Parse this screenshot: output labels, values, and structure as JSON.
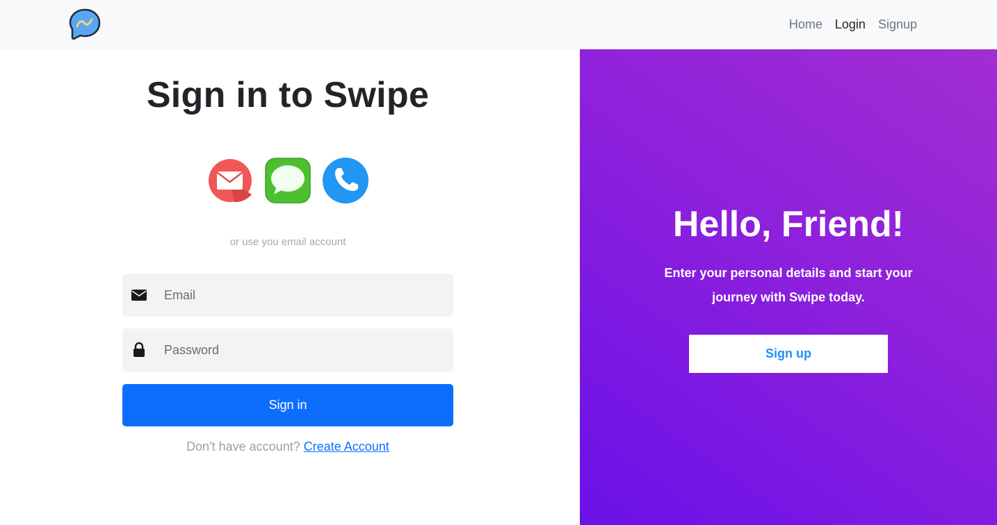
{
  "nav": {
    "brand_icon": "chat-bubble-logo-icon",
    "links": [
      {
        "label": "Home",
        "active": false
      },
      {
        "label": "Login",
        "active": true
      },
      {
        "label": "Signup",
        "active": false
      }
    ]
  },
  "login": {
    "title": "Sign in to Swipe",
    "social_icons": [
      "mail-icon",
      "message-icon",
      "phone-icon"
    ],
    "alt_text": "or use you email account",
    "email_placeholder": "Email",
    "password_placeholder": "Password",
    "submit_label": "Sign in",
    "no_account_text": "Don't have account?",
    "create_account_link": "Create Account"
  },
  "promo": {
    "title": "Hello, Friend!",
    "subtitle": "Enter your personal details and start your journey with Swipe today.",
    "button_label": "Sign up"
  },
  "colors": {
    "primary": "#0d6efd",
    "gradient_start": "#6a11e8",
    "gradient_end": "#a22ed2",
    "signup_text": "#1e90ff",
    "field_bg": "#f3f3f3",
    "navbar_bg": "#f8f9fa"
  }
}
